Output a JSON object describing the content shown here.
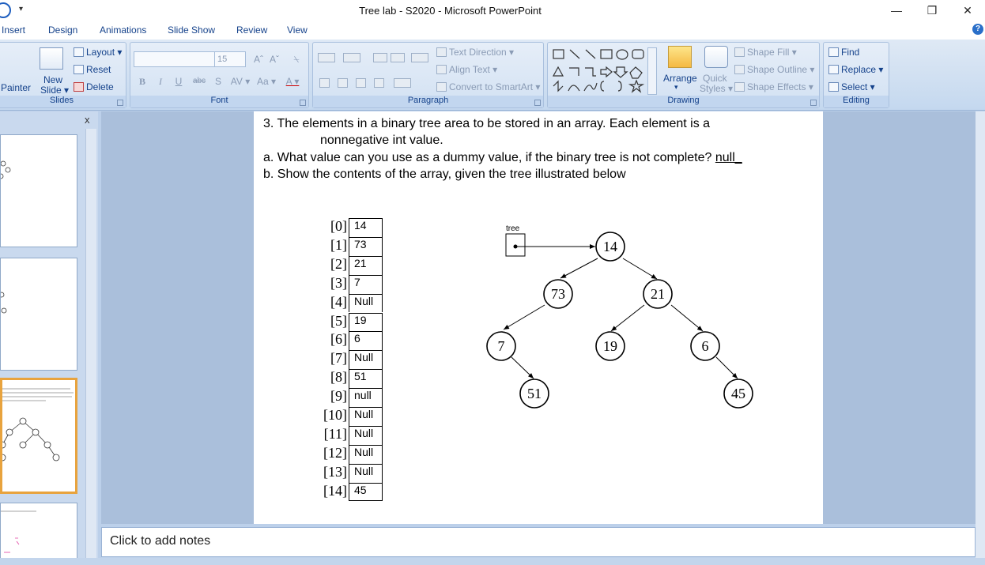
{
  "window": {
    "title": "Tree lab - S2020 - Microsoft PowerPoint",
    "qa_dropdown": "▾",
    "minimize": "—",
    "restore": "❐",
    "close": "✕"
  },
  "tabs": [
    "Insert",
    "Design",
    "Animations",
    "Slide Show",
    "Review",
    "View"
  ],
  "help": "?",
  "ribbon": {
    "slides": {
      "label": "Slides",
      "painter": "Painter",
      "new_slide_1": "New",
      "new_slide_2": "Slide ▾",
      "layout": "Layout ▾",
      "reset": "Reset",
      "delete": "Delete"
    },
    "font": {
      "label": "Font",
      "size": "15",
      "grow": "Aˆ",
      "shrink": "Aˇ",
      "clear": "⍀",
      "bold": "B",
      "italic": "I",
      "underline": "U",
      "strike": "abc",
      "shadow": "S",
      "spacing": "AV ▾",
      "case": "Aa ▾",
      "color": "A ▾"
    },
    "paragraph": {
      "label": "Paragraph",
      "text_direction": "Text Direction ▾",
      "align_text": "Align Text ▾",
      "convert": "Convert to SmartArt ▾"
    },
    "drawing": {
      "label": "Drawing",
      "arrange": "Arrange",
      "arrange_arrow": "▾",
      "quick_1": "Quick",
      "quick_2": "Styles ▾",
      "shape_fill": "Shape Fill ▾",
      "shape_outline": "Shape Outline ▾",
      "shape_effects": "Shape Effects ▾"
    },
    "editing": {
      "label": "Editing",
      "find": "Find",
      "replace": "Replace ▾",
      "select": "Select ▾"
    }
  },
  "slides_pane": {
    "close": "x"
  },
  "slide": {
    "q3_line1": "3.  The elements in a binary tree area to be stored in an array.  Each element is a",
    "q3_line2": "nonnegative int value.",
    "qa_prefix": "a.  What value can you use as a dummy value, if the binary tree is not complete? ",
    "qa_answer": " null_",
    "qb": "b.  Show the contents of the array, given the tree illustrated below",
    "array": [
      {
        "index": "[0]",
        "value": "14"
      },
      {
        "index": "[1]",
        "value": "73"
      },
      {
        "index": "[2]",
        "value": "21"
      },
      {
        "index": "[3]",
        "value": "7"
      },
      {
        "index": "[4]",
        "value": "Null"
      },
      {
        "index": "[5]",
        "value": "19"
      },
      {
        "index": "[6]",
        "value": "6"
      },
      {
        "index": "[7]",
        "value": "Null"
      },
      {
        "index": "[8]",
        "value": "51"
      },
      {
        "index": "[9]",
        "value": "null"
      },
      {
        "index": "[10]",
        "value": "Null"
      },
      {
        "index": "[11]",
        "value": "Null"
      },
      {
        "index": "[12]",
        "value": "Null"
      },
      {
        "index": "[13]",
        "value": "Null"
      },
      {
        "index": "[14]",
        "value": "45"
      }
    ],
    "tree_label": "tree",
    "tree_nodes": [
      "14",
      "73",
      "21",
      "7",
      "19",
      "6",
      "51",
      "45"
    ]
  },
  "notes": {
    "placeholder": "Click to add notes"
  }
}
